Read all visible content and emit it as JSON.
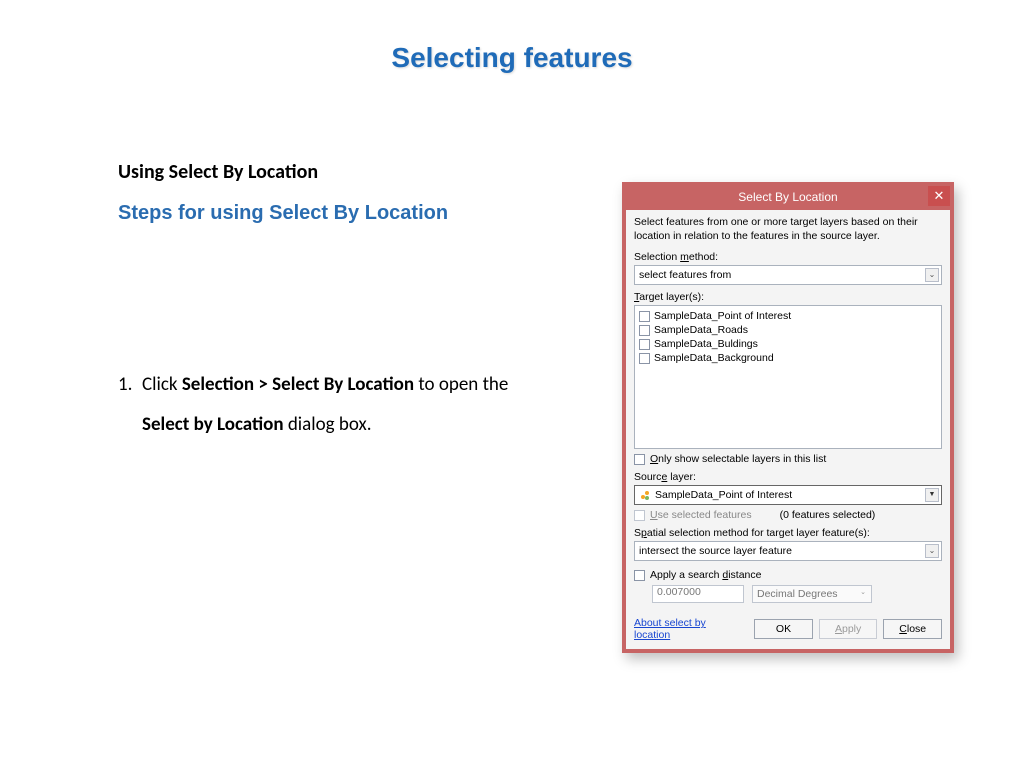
{
  "page": {
    "title": "Selecting features",
    "heading1": "Using Select By Location",
    "heading2": "Steps for using Select By Location",
    "step_num": "1.",
    "step1_a": "Click ",
    "step1_b": "Selection > Select By Location",
    "step1_c": " to open the ",
    "step1_d": "Select by Location",
    "step1_e": " dialog box."
  },
  "dialog": {
    "title": "Select By Location",
    "description": "Select features from one or more target layers based on their location in relation to the features in the source layer.",
    "selmethod_label_pre": "Selection ",
    "selmethod_label_u": "m",
    "selmethod_label_post": "ethod:",
    "selmethod_value": "select features from",
    "target_label_u": "T",
    "target_label_post": "arget layer(s):",
    "layers": [
      "SampleData_Point of Interest",
      "SampleData_Roads",
      "SampleData_Buldings",
      "SampleData_Background"
    ],
    "only_u": "O",
    "only_post": "nly show selectable layers in this list",
    "source_label_pre": "Sourc",
    "source_label_u": "e",
    "source_label_post": " layer:",
    "source_value": "SampleData_Point of Interest",
    "use_sel_u": "U",
    "use_sel_post": "se selected features",
    "features_selected": "(0 features selected)",
    "spatial_pre": "S",
    "spatial_u": "p",
    "spatial_post": "atial selection method for target layer feature(s):",
    "spatial_value": "intersect the source layer feature",
    "applydist_pre": "Apply a search ",
    "applydist_u": "d",
    "applydist_post": "istance",
    "dist_value": "0.007000",
    "dist_units": "Decimal Degrees",
    "link": "About select by location",
    "ok": "OK",
    "apply_u": "A",
    "apply_post": "pply",
    "close_u": "C",
    "close_post": "lose"
  }
}
